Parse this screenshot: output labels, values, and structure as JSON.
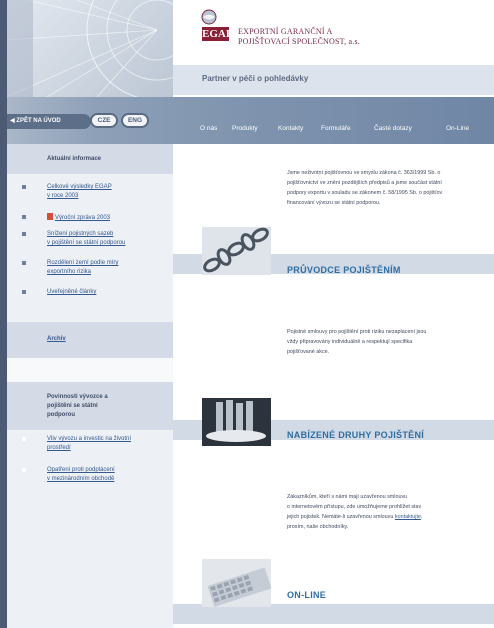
{
  "header": {
    "logo_text": "EGAP",
    "company_line1": "EXPORTNÍ GARANČNÍ A",
    "company_line2": "POJIŠŤOVACÍ SPOLEČNOST, a.s.",
    "tagline": "Partner v péči o pohledávky"
  },
  "toolbar": {
    "back_label": "ZPĚT NA ÚVOD",
    "lang_cze": "CZE",
    "lang_eng": "ENG"
  },
  "nav": {
    "items": [
      "O nás",
      "Produkty",
      "Kontakty",
      "Formuláře",
      "Časté dotazy",
      "On-Line"
    ]
  },
  "sidebar": {
    "section1_title": "Aktuální informace",
    "news": [
      {
        "line1": "Celkové výsledky EGAP",
        "line2": "v roce 2003"
      },
      {
        "line1": "Výroční zpráva 2003",
        "line2": ""
      },
      {
        "line1": "Snížení pojistných sazeb",
        "line2": "v pojištění se státní podporou"
      },
      {
        "line1": "Rozdělení zemí podle míry",
        "line2": "exportního rizika"
      },
      {
        "line1": "Uveřejněné článkу",
        "line2": ""
      }
    ],
    "archive_label": "Archiv",
    "section2_title_l1": "Povinnosti vývozce a",
    "section2_title_l2": "pojištění se státní",
    "section2_title_l3": "podporou",
    "links2": [
      {
        "line1": "Vliv vývozu a investic na životní",
        "line2": "prostředí"
      },
      {
        "line1": "Opatření proti podplácení",
        "line2": "v mezinárodním obchodě"
      }
    ]
  },
  "main": {
    "intro": [
      "Jsme neživotní pojišťovnou ve smyslu zákona č. 363/1999 Sb. o",
      "pojišťovnictví ve znění pozdějších předpisů a jsme součást státní",
      "podpory exportu v souladu se zákonem č. 58/1995 Sb. o pojišťov",
      "financování vývozu se státní podporou."
    ],
    "section1_title": "PRŮVODCE POJIŠTĚNÍM",
    "section1_text": [
      "Pojistné smlouvy pro pojištění proti riziku nezaplacení jsou",
      "vždy připravovány individuálně a respektují specifika",
      "pojišťované akce."
    ],
    "section2_title": "NABÍZENÉ DRUHY POJIŠTĚNÍ",
    "section3_text": [
      "Zákazníkům, kteří s námi mají uzavřenou smlouvu",
      "o internetovém přístupu, zde umožňujeme prohlížet stav",
      "jejich pojistek. Nemáte-li uzavřenou smlouvu",
      "prosím, naše obchodníky."
    ],
    "section3_link": "kontaktujte",
    "section3_punct": ",",
    "section3_title": "ON-LINE"
  },
  "colors": {
    "brand": "#8a2036",
    "nav_band": "#7f93ae",
    "title_blue": "#2f6ea3",
    "link_blue": "#34598f"
  }
}
